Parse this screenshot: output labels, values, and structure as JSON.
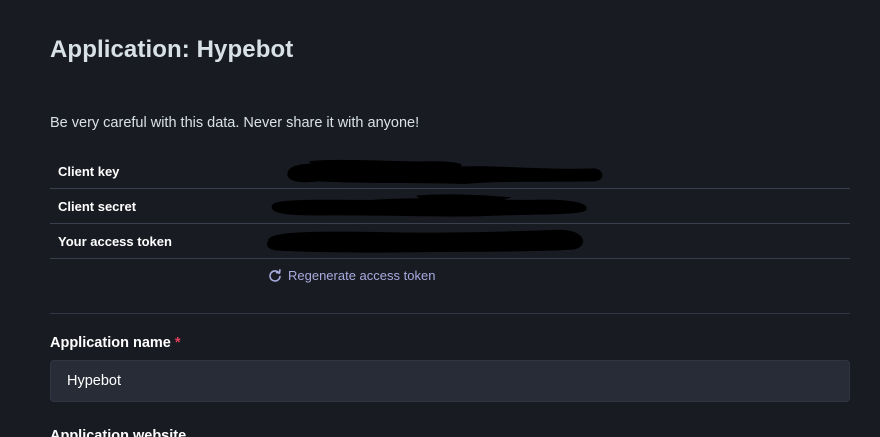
{
  "page": {
    "title": "Application: Hypebot",
    "warning": "Be very careful with this data. Never share it with anyone!"
  },
  "credentials": [
    {
      "label": "Client key",
      "value_redacted": true
    },
    {
      "label": "Client secret",
      "value_redacted": true
    },
    {
      "label": "Your access token",
      "value_redacted": true
    }
  ],
  "regenerate": {
    "label": "Regenerate access token",
    "icon": "refresh-icon"
  },
  "form": {
    "app_name": {
      "label": "Application name",
      "required_marker": "*",
      "value": "Hypebot"
    },
    "app_website": {
      "label": "Application website"
    }
  },
  "colors": {
    "background": "#191b22",
    "input_background": "#282c37",
    "link": "#a7abdd",
    "required": "#df405a"
  }
}
